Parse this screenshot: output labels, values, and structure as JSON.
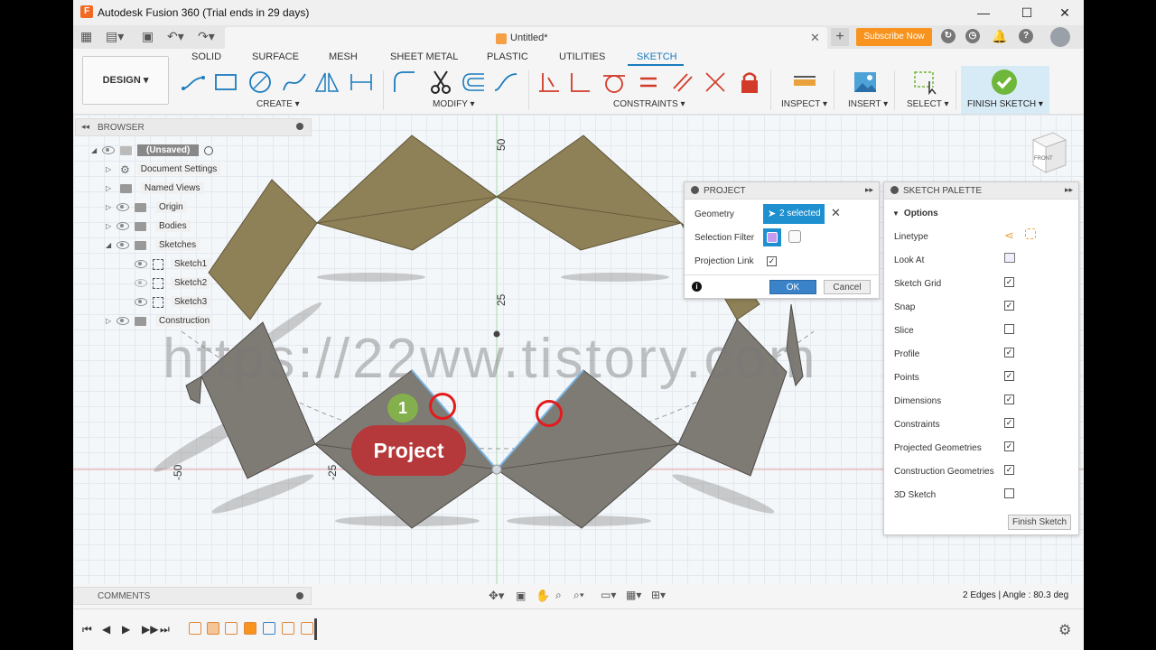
{
  "window": {
    "title": "Autodesk Fusion 360 (Trial ends in 29 days)",
    "minimize": "—",
    "maximize": "☐",
    "close": "✕"
  },
  "tabbar": {
    "doc_title": "Untitled*",
    "subscribe_label": "Subscribe Now"
  },
  "ribbon": {
    "workspace": "DESIGN ▾",
    "tabs": [
      "SOLID",
      "SURFACE",
      "MESH",
      "SHEET METAL",
      "PLASTIC",
      "UTILITIES",
      "SKETCH"
    ],
    "groups": {
      "create": "CREATE ▾",
      "modify": "MODIFY ▾",
      "constraints": "CONSTRAINTS ▾",
      "inspect": "INSPECT ▾",
      "insert": "INSERT ▾",
      "select": "SELECT ▾",
      "finish": "FINISH SKETCH ▾"
    }
  },
  "browser": {
    "title": "BROWSER",
    "root": "(Unsaved)",
    "items": [
      {
        "label": "Document Settings"
      },
      {
        "label": "Named Views"
      },
      {
        "label": "Origin"
      },
      {
        "label": "Bodies"
      },
      {
        "label": "Sketches"
      },
      {
        "label": "Sketch1"
      },
      {
        "label": "Sketch2"
      },
      {
        "label": "Sketch3"
      },
      {
        "label": "Construction"
      }
    ]
  },
  "project_dialog": {
    "title": "PROJECT",
    "geometry_label": "Geometry",
    "geometry_value": "2 selected",
    "selection_filter_label": "Selection Filter",
    "projection_link_label": "Projection Link",
    "projection_link_checked": true,
    "ok": "OK",
    "cancel": "Cancel"
  },
  "sketch_palette": {
    "title": "SKETCH PALETTE",
    "section": "Options",
    "rows": [
      {
        "label": "Linetype"
      },
      {
        "label": "Look At"
      },
      {
        "label": "Sketch Grid",
        "checked": true
      },
      {
        "label": "Snap",
        "checked": true
      },
      {
        "label": "Slice",
        "checked": false
      },
      {
        "label": "Profile",
        "checked": true
      },
      {
        "label": "Points",
        "checked": true
      },
      {
        "label": "Dimensions",
        "checked": true
      },
      {
        "label": "Constraints",
        "checked": true
      },
      {
        "label": "Projected Geometries",
        "checked": true
      },
      {
        "label": "Construction Geometries",
        "checked": true
      },
      {
        "label": "3D Sketch",
        "checked": false
      }
    ],
    "finish_button": "Finish Sketch"
  },
  "canvas": {
    "axis_labels": [
      "50",
      "25",
      "-50",
      "-25"
    ],
    "viewcube_label": "FRONT"
  },
  "comments": {
    "title": "COMMENTS"
  },
  "status": {
    "text": "2 Edges | Angle : 80.3 deg"
  },
  "overlay": {
    "watermark": "https://22ww.tistory.com",
    "step": "1",
    "callout": "Project"
  },
  "colors": {
    "accent": "#1a7bbd",
    "selected": "#1e90d0",
    "subscribe": "#f7931e",
    "finish": "#6fb73b",
    "callout": "#b5383a",
    "ring": "#e41b1b",
    "step": "#83b04c"
  }
}
